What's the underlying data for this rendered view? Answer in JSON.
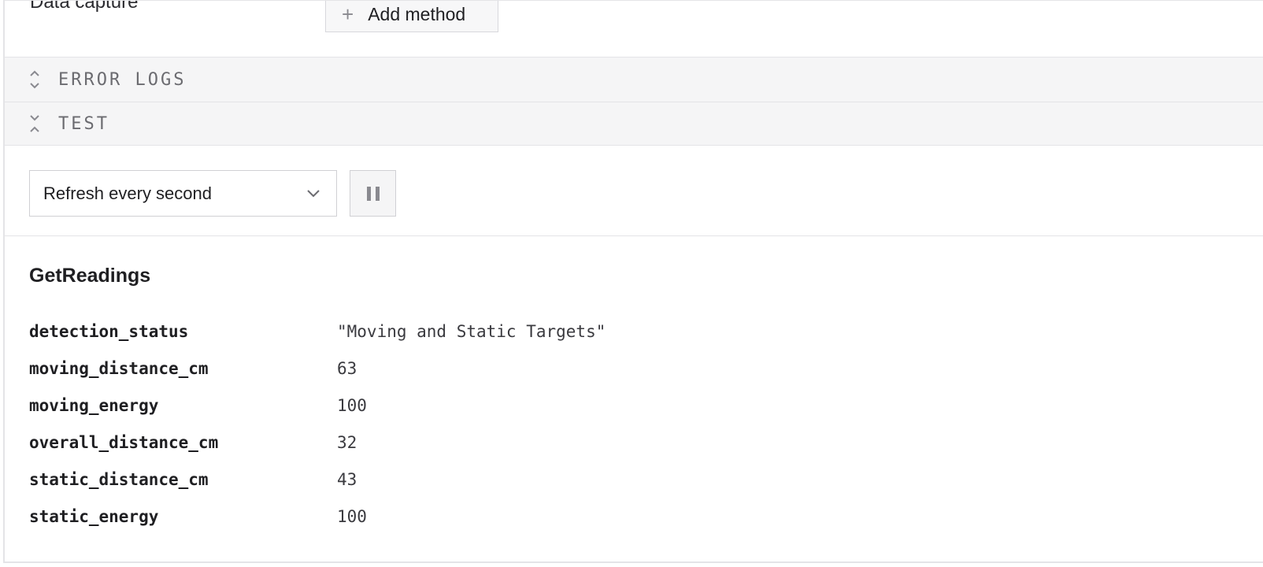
{
  "capture": {
    "label": "Data capture",
    "add_method_label": "Add method"
  },
  "sections": {
    "error_logs": "ERROR LOGS",
    "test": "TEST"
  },
  "controls": {
    "refresh_selected": "Refresh every second"
  },
  "readings": {
    "title": "GetReadings",
    "rows": [
      {
        "key": "detection_status",
        "value": "\"Moving and Static Targets\""
      },
      {
        "key": "moving_distance_cm",
        "value": "63"
      },
      {
        "key": "moving_energy",
        "value": "100"
      },
      {
        "key": "overall_distance_cm",
        "value": "32"
      },
      {
        "key": "static_distance_cm",
        "value": "43"
      },
      {
        "key": "static_energy",
        "value": "100"
      }
    ]
  },
  "colors": {
    "header_bg": "#f5f5f6",
    "border": "#e4e4e7",
    "muted_text": "#6b6b70"
  },
  "icons": {
    "add": "plus-icon",
    "error_logs_toggle": "chevron-expand-icon",
    "test_toggle": "chevron-collapse-icon",
    "select_caret": "chevron-down-icon",
    "pause": "pause-icon"
  }
}
